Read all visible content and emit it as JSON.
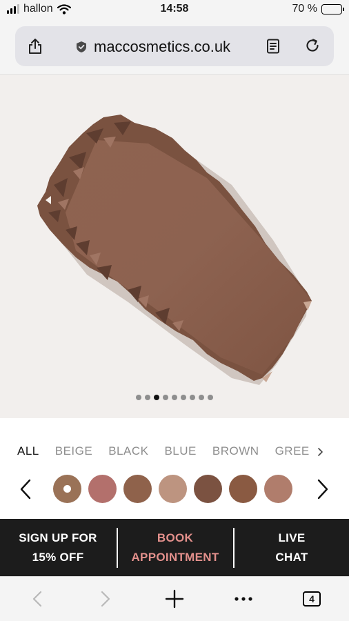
{
  "status_bar": {
    "carrier": "hallon",
    "time": "14:58",
    "battery": "70 %",
    "battery_level_percent": 70
  },
  "browser": {
    "url": "maccosmetics.co.uk",
    "icons": [
      "share-icon",
      "shield-icon",
      "reader-icon",
      "reload-icon"
    ]
  },
  "product": {
    "image_pages": 9,
    "active_page": 3
  },
  "filters": {
    "tabs": [
      "ALL",
      "BEIGE",
      "BLACK",
      "BLUE",
      "BROWN",
      "GREE"
    ],
    "active": "ALL"
  },
  "shades": {
    "colors": [
      "#9a7257",
      "#b3706c",
      "#8f624b",
      "#bd9480",
      "#7b5241",
      "#8a5a42",
      "#b07d6c"
    ],
    "selected_index": 0
  },
  "cta": {
    "signup_line1": "SIGN UP FOR",
    "signup_line2": "15% OFF",
    "book_line1": "BOOK",
    "book_line2": "APPOINTMENT",
    "chat_line1": "LIVE",
    "chat_line2": "CHAT",
    "book_color": "#e3908c"
  },
  "toolbar": {
    "tab_count": "4"
  }
}
